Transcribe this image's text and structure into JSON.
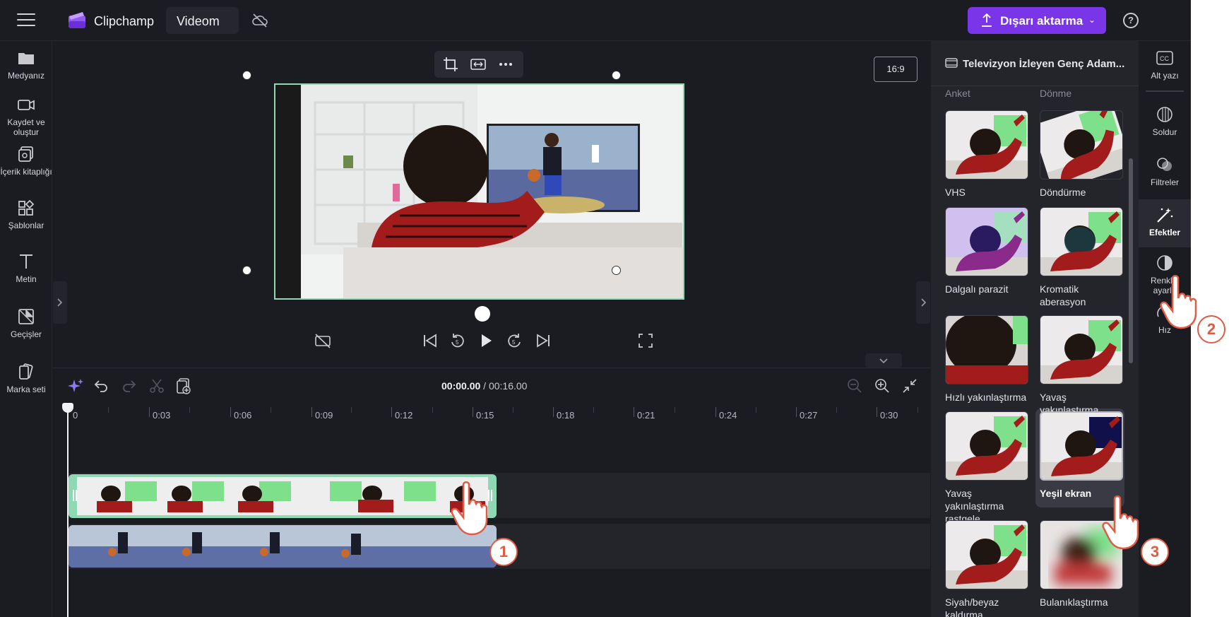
{
  "header": {
    "app_name": "Clipchamp",
    "project_name": "Videom",
    "export_label": "Dışarı aktarma",
    "help": "?"
  },
  "left_rail": [
    {
      "label": "Medyanız",
      "icon": "folder-icon"
    },
    {
      "label": "Kaydet ve oluştur",
      "icon": "camera-icon"
    },
    {
      "label": "İçerik kitaplığı",
      "icon": "library-icon"
    },
    {
      "label": "Şablonlar",
      "icon": "templates-icon"
    },
    {
      "label": "Metin",
      "icon": "text-icon"
    },
    {
      "label": "Geçişler",
      "icon": "transitions-icon"
    },
    {
      "label": "Marka seti",
      "icon": "brand-kit-icon"
    }
  ],
  "preview": {
    "aspect_ratio": "16:9"
  },
  "timeline": {
    "current_time": "00:00.00",
    "separator": " / ",
    "total_time": "00:16.00",
    "ruler": [
      "0",
      "0:03",
      "0:06",
      "0:09",
      "0:12",
      "0:15",
      "0:18",
      "0:21",
      "0:24",
      "0:27",
      "0:30"
    ]
  },
  "effects_panel": {
    "title": "Televizyon İzleyen Genç Adam...",
    "cut_labels": [
      "Anket",
      "Dönme"
    ],
    "effects": [
      {
        "label": "VHS",
        "style": "normal"
      },
      {
        "label": "Döndürme",
        "style": "rotated"
      },
      {
        "label": "Dalgalı parazit",
        "style": "purple"
      },
      {
        "label": "Kromatik aberasyon",
        "style": "chromatic"
      },
      {
        "label": "Hızlı yakınlaştırma",
        "style": "zoomed"
      },
      {
        "label": "Yavaş yakınlaştırma",
        "style": "normal"
      },
      {
        "label": "Yavaş yakınlaştırma rastgele",
        "style": "normal"
      },
      {
        "label": "Yeşil ekran",
        "style": "greenscreen",
        "selected": true
      },
      {
        "label": "Siyah/beyaz kaldırma",
        "style": "normal"
      },
      {
        "label": "Bulanıklaştırma",
        "style": "blur"
      }
    ]
  },
  "right_rail": [
    {
      "label": "Alt yazı",
      "icon": "captions-icon"
    },
    {
      "label": "Soldur",
      "icon": "fade-icon"
    },
    {
      "label": "Filtreler",
      "icon": "filters-icon"
    },
    {
      "label": "Efektler",
      "icon": "effects-icon",
      "active": true
    },
    {
      "label": "Renkleri ayarla",
      "icon": "adjust-colors-icon"
    },
    {
      "label": "Hız",
      "icon": "speed-icon"
    }
  ],
  "annotations": [
    "1",
    "2",
    "3"
  ],
  "colors": {
    "accent": "#7a35e8",
    "selection": "#8fd8b4",
    "badge": "#e05a44",
    "background": "#1b1b22"
  }
}
